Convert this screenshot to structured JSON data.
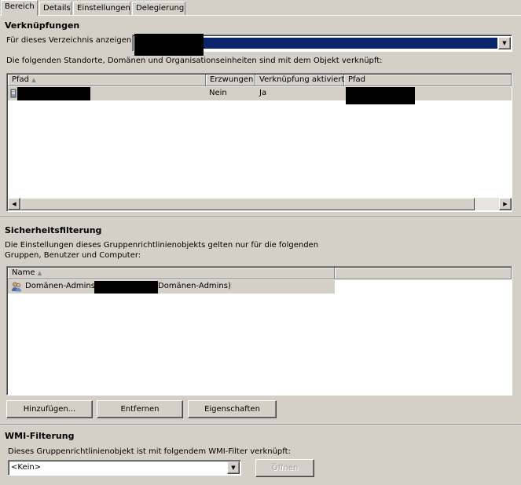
{
  "tabs": [
    "Bereich",
    "Details",
    "Einstellungen",
    "Delegierung"
  ],
  "links": {
    "title": "Verknüpfungen",
    "show_label": "Für dieses Verzeichnis anzeigen:",
    "description": "Die folgenden Standorte, Domänen und Organisationseinheiten sind mit dem Objekt verknüpft:",
    "columns": [
      "Pfad",
      "Erzwungen",
      "Verknüpfung aktiviert",
      "Pfad"
    ],
    "rows": [
      {
        "enforced": "Nein",
        "enabled": "Ja"
      }
    ]
  },
  "security": {
    "title": "Sicherheitsfilterung",
    "description_line1": "Die Einstellungen dieses Gruppenrichtlinienobjekts gelten nur für die folgenden",
    "description_line2": "Gruppen, Benutzer und Computer:",
    "column_name": "Name",
    "rows": [
      {
        "name_prefix": "Domänen-Admins",
        "name_suffix": "Domänen-Admins)"
      }
    ],
    "add_button": "Hinzufügen...",
    "remove_button": "Entfernen",
    "properties_button": "Eigenschaften"
  },
  "wmi": {
    "title": "WMI-Filterung",
    "description": "Dieses Gruppenrichtlinienobjekt ist mit folgendem WMI-Filter verknüpft:",
    "selected": "<Kein>",
    "open_button": "Öffnen"
  },
  "colors": {
    "face": "#d4d0c8",
    "highlight_bar": "#0a246a",
    "window": "#ffffff"
  }
}
